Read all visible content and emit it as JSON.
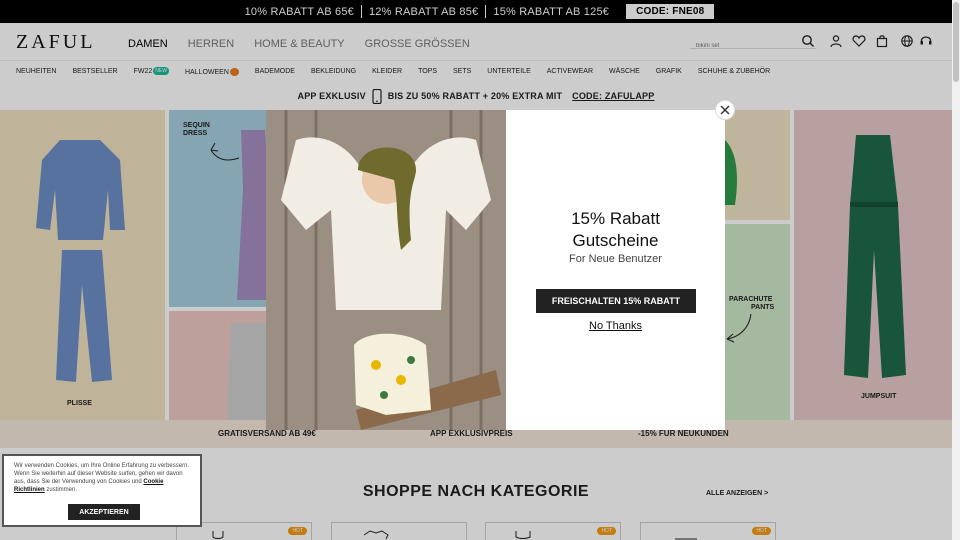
{
  "promo": {
    "offer1": "10% RABATT AB 65€",
    "offer2": "12% RABATT AB 85€",
    "offer3": "15% RABATT AB 125€",
    "code": "CODE: FNE08"
  },
  "header": {
    "logo": "ZAFUL",
    "nav": [
      "DAMEN",
      "HERREN",
      "HOME & BEAUTY",
      "GROSSE GRÖSSEN"
    ],
    "search_placeholder": "bikini set"
  },
  "categories": {
    "items": [
      "NEUHEITEN",
      "BESTSELLER",
      "FW22",
      "HALLOWEEN",
      "BADEMODE",
      "BEKLEIDUNG",
      "KLEIDER",
      "TOPS",
      "SETS",
      "UNTERTEILE",
      "ACTIVEWEAR",
      "WÄSCHE",
      "GRAFIK",
      "SCHUHE & ZUBEHÖR"
    ],
    "new_badge": "NEW"
  },
  "app_banner": {
    "left": "APP EXKLUSIV",
    "middle": "BIS ZU 50% RABATT + 20% EXTRA MIT",
    "code": "CODE: ZAFULAPP"
  },
  "hero": {
    "plisse": "PLISSE",
    "sequin_line1": "SEQUIN",
    "sequin_line2": "DRESS",
    "parachute_line1": "PARACHUTE",
    "parachute_line2": "PANTS",
    "jumpsuit": "JUMPSUIT"
  },
  "perks": {
    "shipping": "GRATISVERSAND AB 49€",
    "app_price": "APP EXKLUSIVPREIS",
    "new_customer": "-15% FÜR NEUKUNDEN"
  },
  "modal": {
    "title_line1": "15% Rabatt",
    "title_line2": "Gutscheine",
    "subtitle": "For Neue Benutzer",
    "cta": "FREISCHALTEN 15% RABATT",
    "no_thanks": "No Thanks"
  },
  "cookie": {
    "text": "Wir verwenden Cookies, um Ihre Online Erfahrung zu verbessern. Wenn Sie weiterhin auf dieser Website surfen, gehen wir davon aus, dass Sie der Verwendung von Cookies und",
    "link": "Cookie Richtlinien",
    "suffix": "zustimmen.",
    "button": "AKZEPTIEREN"
  },
  "shop": {
    "title": "SHOPPE NACH KATEGORIE",
    "see_all": "ALLE ANZEIGEN >",
    "hot_badge": "HOT"
  },
  "colors": {
    "accent_new": "#1abc9c",
    "hot": "#f39c12",
    "promo_bg": "#000000"
  }
}
